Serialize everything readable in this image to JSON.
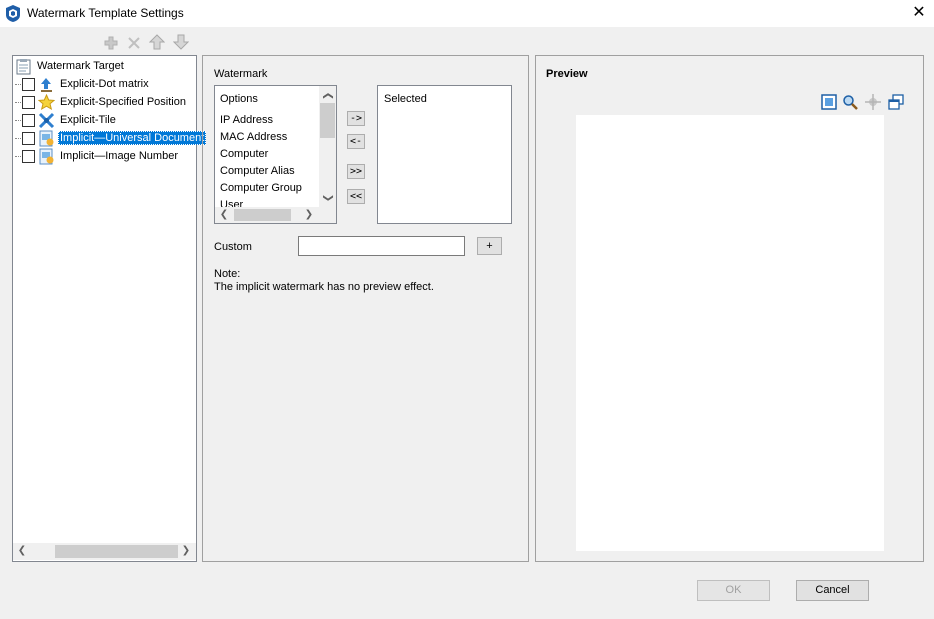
{
  "window": {
    "title": "Watermark Template Settings",
    "close_glyph": "✕"
  },
  "toolbar": {
    "icons": [
      "add-icon",
      "delete-icon",
      "move-up-icon",
      "move-down-icon"
    ]
  },
  "tree": {
    "root_label": "Watermark Target",
    "items": [
      {
        "label": "Explicit-Dot matrix",
        "icon": "dot-matrix-icon",
        "checked": false,
        "selected": false
      },
      {
        "label": "Explicit-Specified Position",
        "icon": "star-icon",
        "checked": false,
        "selected": false
      },
      {
        "label": "Explicit-Tile",
        "icon": "tile-icon",
        "checked": false,
        "selected": false
      },
      {
        "label": "Implicit—Universal Document",
        "icon": "document-icon",
        "checked": false,
        "selected": true
      },
      {
        "label": "Implicit—Image Number",
        "icon": "image-icon",
        "checked": false,
        "selected": false
      }
    ]
  },
  "watermark": {
    "group_label": "Watermark",
    "options_header": "Options",
    "options": [
      "IP Address",
      "MAC Address",
      "Computer",
      "Computer Alias",
      "Computer Group",
      "User"
    ],
    "selected_header": "Selected",
    "buttons": {
      "add_one": "->",
      "remove_one": "<-",
      "add_all": ">>",
      "remove_all": "<<"
    },
    "custom_label": "Custom",
    "custom_value": "",
    "custom_add": "+",
    "note_title": "Note:",
    "note_text": "The implicit watermark has no preview effect."
  },
  "preview": {
    "label": "Preview",
    "icons": [
      "fit-page-icon",
      "zoom-icon",
      "pan-icon",
      "restore-icon"
    ]
  },
  "footer": {
    "ok_label": "OK",
    "cancel_label": "Cancel"
  },
  "colors": {
    "selection": "#0078d7",
    "background": "#f0f0f0"
  }
}
